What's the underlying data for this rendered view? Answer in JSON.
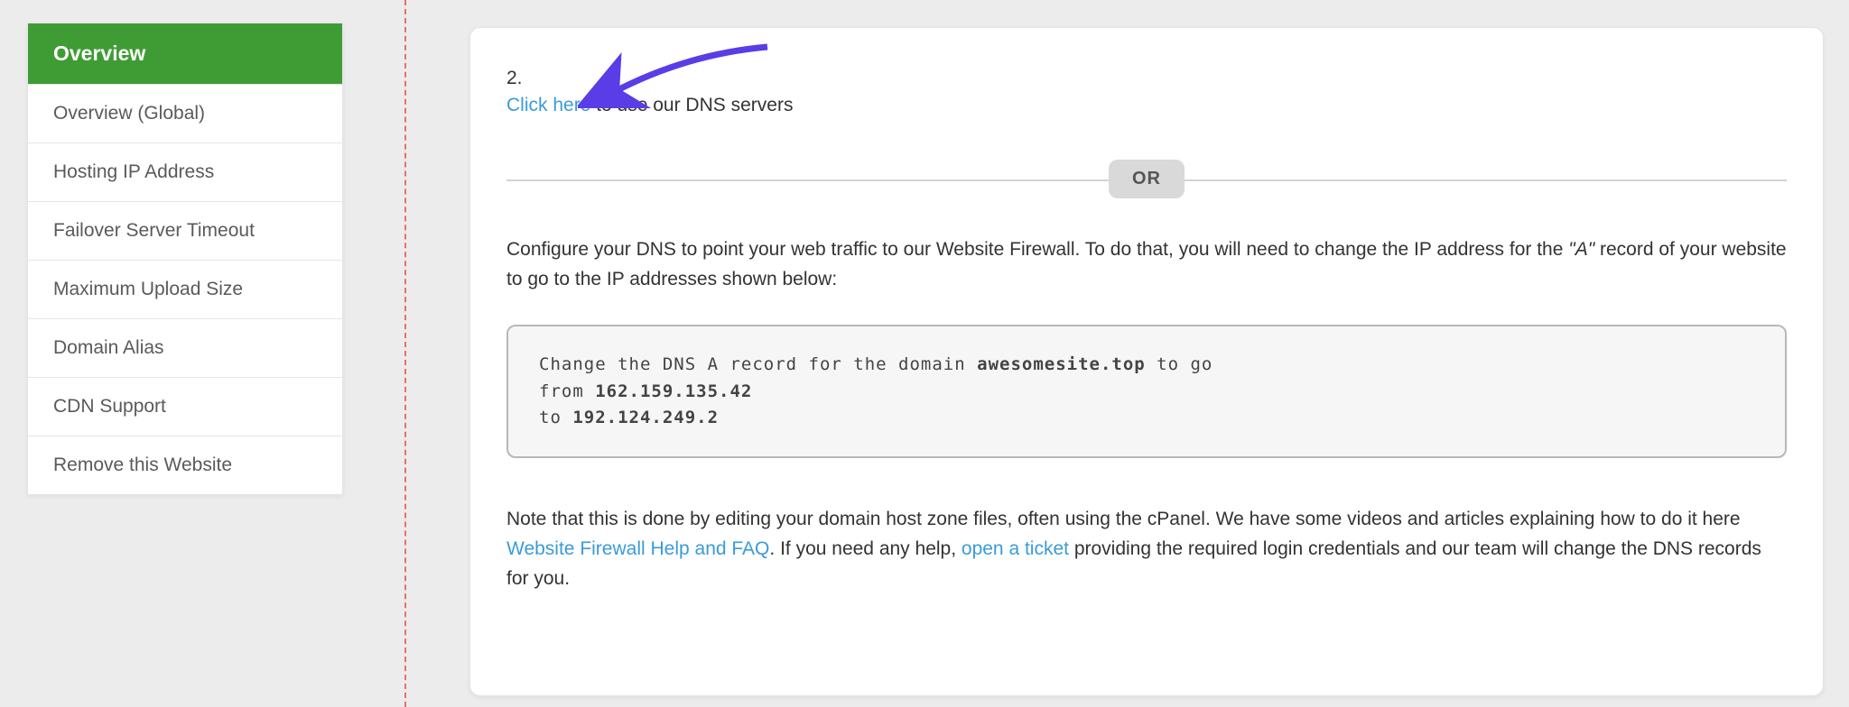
{
  "sidebar": {
    "items": [
      {
        "label": "Overview"
      },
      {
        "label": "Overview (Global)"
      },
      {
        "label": "Hosting IP Address"
      },
      {
        "label": "Failover Server Timeout"
      },
      {
        "label": "Maximum Upload Size"
      },
      {
        "label": "Domain Alias"
      },
      {
        "label": "CDN Support"
      },
      {
        "label": "Remove this Website"
      }
    ]
  },
  "main": {
    "step_number": "2.",
    "click_here": "Click here",
    "click_here_rest": " to use our DNS servers",
    "or_label": "OR",
    "configure_pre": "Configure your DNS to point your web traffic to our Website Firewall. To do that, you will need to change the IP address for the ",
    "configure_rec": "\"A\"",
    "configure_post": " record of your website to go to the IP addresses shown below:",
    "code": {
      "line1_pre": "Change the DNS A record for the domain ",
      "domain": "awesomesite.top",
      "line1_post": " to go",
      "line2_pre": "from ",
      "from_ip": "162.159.135.42",
      "line3_pre": "to ",
      "to_ip": "192.124.249.2"
    },
    "note_pre": "Note that this is done by editing your domain host zone files, often using the cPanel. We have some videos and articles explaining how to do it here ",
    "note_link1": "Website Firewall Help and FAQ",
    "note_mid": ". If you need any help, ",
    "note_link2": "open a ticket",
    "note_post": " providing the required login credentials and our team will change the DNS records for you."
  }
}
